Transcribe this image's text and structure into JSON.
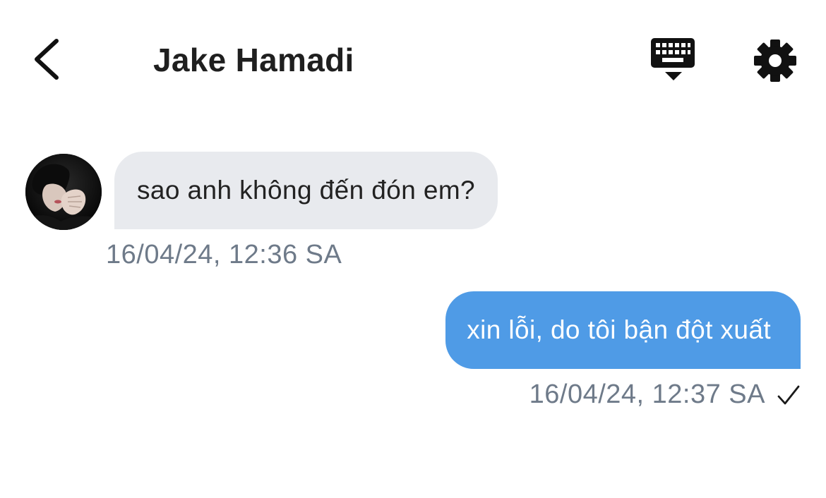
{
  "header": {
    "contact_name": "Jake Hamadi",
    "back_icon": "chevron-left-icon",
    "keyboard_icon": "keyboard-hide-icon",
    "settings_icon": "gear-icon"
  },
  "messages": [
    {
      "direction": "incoming",
      "text": "sao anh không đến đón em?",
      "timestamp": "16/04/24, 12:36 SA"
    },
    {
      "direction": "outgoing",
      "text": "xin lỗi, do tôi bận đột xuất",
      "timestamp": "16/04/24, 12:37 SA",
      "status_icon": "checkmark-icon"
    }
  ],
  "colors": {
    "incoming_bubble": "#e8eaee",
    "outgoing_bubble": "#4f9be6",
    "timestamp": "#6e7a89",
    "title": "#1f1f1f"
  }
}
